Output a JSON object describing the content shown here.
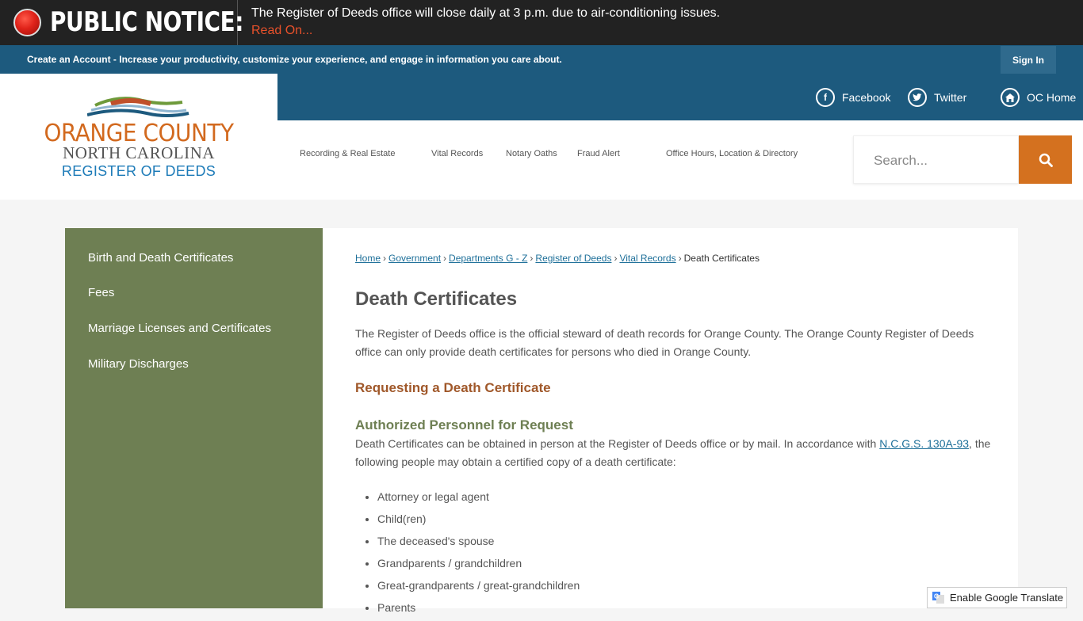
{
  "notice": {
    "title": "PUBLIC NOTICE:",
    "message": "The Register of Deeds office will close daily at 3 p.m. due to air-conditioning issues.",
    "link": "Read On..."
  },
  "account": {
    "create": "Create an Account",
    "tagline": " - Increase your productivity, customize your experience, and engage in information you care about.",
    "signin": "Sign In"
  },
  "logo": {
    "line1": "ORANGE COUNTY",
    "line2": "NORTH CAROLINA",
    "line3": "REGISTER OF DEEDS"
  },
  "social": {
    "facebook": "Facebook",
    "twitter": "Twitter",
    "home": "OC Home"
  },
  "nav": [
    "Recording & Real Estate",
    "Vital Records",
    "Notary Oaths",
    "Fraud Alert",
    "Office Hours, Location & Directory"
  ],
  "search": {
    "placeholder": "Search..."
  },
  "sidebar": [
    "Birth and Death Certificates",
    "Fees",
    "Marriage Licenses and Certificates",
    "Military Discharges"
  ],
  "breadcrumb": {
    "links": [
      "Home",
      "Government",
      "Departments G - Z",
      "Register of Deeds",
      "Vital Records"
    ],
    "sep": "›",
    "current": "Death Certificates"
  },
  "main": {
    "title": "Death Certificates",
    "intro": "The Register of Deeds office is the official steward of death records for Orange County. The Orange County Register of Deeds office can only provide death certificates for persons who died in Orange County.",
    "heading1": "Requesting a Death Certificate",
    "heading2": "Authorized Personnel for Request",
    "para2_before": "Death Certificates can be obtained in person at the Register of Deeds office or by mail. In accordance with ",
    "para2_link": "N.C.G.S. 130A-93",
    "para2_after": ", the following people may obtain a certified copy of a death certificate:",
    "list": [
      "Attorney or legal agent",
      "Child(ren)",
      "The deceased's spouse",
      "Grandparents / grandchildren",
      "Great-grandparents / great-grandchildren",
      "Parents"
    ]
  },
  "translate": {
    "label": "Enable Google Translate"
  },
  "colors": {
    "accent_orange": "#d4711f",
    "nav_blue": "#1d5a7e",
    "sidebar_green": "#6e7f53",
    "notice_red": "#e8512b"
  }
}
